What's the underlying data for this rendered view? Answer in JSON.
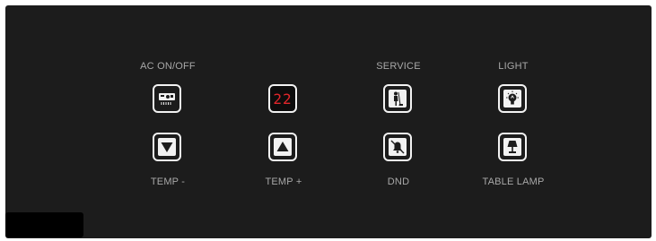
{
  "labels": {
    "ac_on_off": "AC ON/OFF",
    "service": "SERVICE",
    "light": "LIGHT",
    "temp_minus": "TEMP -",
    "temp_plus": "TEMP +",
    "dnd": "DND",
    "table_lamp": "TABLE LAMP"
  },
  "temperature_display": "22",
  "icons": {
    "ac": "air-conditioner-icon",
    "service": "cleaning-service-icon",
    "light": "light-bulb-icon",
    "temp_down": "triangle-down-icon",
    "temp_up": "triangle-up-icon",
    "dnd": "bell-muted-icon",
    "table_lamp": "table-lamp-icon"
  },
  "colors": {
    "panel": "#1c1c1c",
    "key_outline": "#f2f2f2",
    "label_text": "#a8a8a8",
    "display_digits": "#e0262b"
  }
}
